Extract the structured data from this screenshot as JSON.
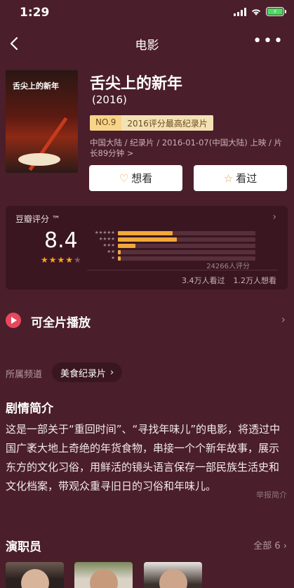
{
  "status_bar": {
    "time": "1:29",
    "battery_icon": "battery-charging-icon"
  },
  "nav": {
    "title": "电影",
    "back_icon": "chevron-left-icon",
    "more_icon": "more-horizontal-icon",
    "more_glyph": "•••"
  },
  "movie": {
    "poster_title": "舌尖上的新年",
    "title": "舌尖上的新年",
    "year": "(2016)",
    "rank_no": "NO.9",
    "rank_text": "2016评分最高纪录片",
    "meta": "中国大陆 / 纪录片 / 2016-01-07(中国大陆) 上映 / 片长89分钟 >"
  },
  "actions": {
    "want_icon": "heart-plus-icon",
    "want_glyph": "♡",
    "want_label": "想看",
    "seen_icon": "star-outline-icon",
    "seen_glyph": "☆",
    "seen_label": "看过"
  },
  "rating": {
    "label": "豆瓣评分 ™",
    "arrow": "›",
    "score": "8.4",
    "stars_filled": "★★★★",
    "stars_empty": "★",
    "stars_value": 4,
    "distribution": [
      {
        "stars": "★★★★★",
        "fraction": 0.4
      },
      {
        "stars": "★★★★",
        "fraction": 0.43
      },
      {
        "stars": "★★★",
        "fraction": 0.13
      },
      {
        "stars": "★★",
        "fraction": 0.02
      },
      {
        "stars": "★",
        "fraction": 0.02
      }
    ],
    "count": "24266人评分",
    "watched": "3.4万人看过",
    "wanted": "1.2万人想看"
  },
  "play": {
    "label": "可全片播放",
    "arrow": "›",
    "icon": "play-circle-icon"
  },
  "channel": {
    "label": "所属频道",
    "chip": "美食纪录片",
    "chip_arrow": "›"
  },
  "synopsis": {
    "title": "剧情简介",
    "text": "这是一部关于“重回时间”、“寻找年味儿”的电影，将透过中国广袤大地上奇绝的年货食物，串接一个个新年故事，展示东方的文化习俗，用鲜活的镜头语言保存一部民族生活史和文化档案，带观众重寻旧日的习俗和年味儿。",
    "report": "举报简介"
  },
  "cast": {
    "title": "演职员",
    "all": "全部 6 ›"
  },
  "colors": {
    "background": "#4a1e2a",
    "accent_star": "#f5a623",
    "play_red": "#e8485c"
  }
}
